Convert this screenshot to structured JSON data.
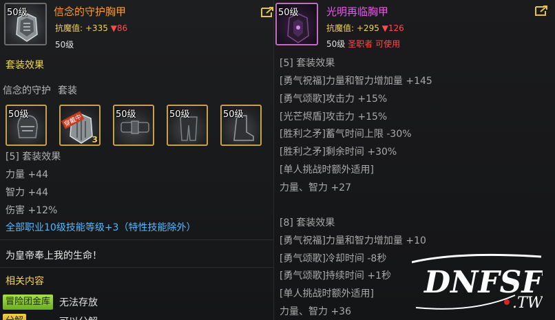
{
  "left": {
    "item": {
      "level": "50级",
      "name": "信念的守护胸甲",
      "stat_label": "抗魔值:",
      "stat_up": "+335",
      "stat_down": "▼86",
      "level_text": "50级"
    },
    "set_effect_title": "套装效果",
    "set_name": "信念的守护",
    "set_suffix": "套装",
    "set_slots": [
      {
        "level": "50级",
        "icon": "helmet-icon"
      },
      {
        "level": "",
        "icon": "chest-armor-icon",
        "banner": "穿戴中",
        "badge": "3"
      },
      {
        "level": "50级",
        "icon": "belt-icon"
      },
      {
        "level": "50级",
        "icon": "pants-icon"
      },
      {
        "level": "50级",
        "icon": "boots-icon"
      }
    ],
    "effects": [
      "[5] 套装效果",
      "力量 +44",
      "智力 +44",
      "伤害 +12%"
    ],
    "skill_bonus": "全部职业10级技能等级+3（特性技能除外）",
    "quote": "为皇帝奉上我的生命！",
    "related_title": "相关内容",
    "tags": [
      {
        "label": "冒险团金库",
        "desc": "无法存放",
        "color": "#8cc832"
      },
      {
        "label": "分解",
        "desc": "可以分解",
        "color": "#e0b030"
      }
    ]
  },
  "right": {
    "item": {
      "level": "50级",
      "name": "光明再临胸甲",
      "stat_label": "抗魔值:",
      "stat_up": "+295",
      "stat_down": "▼126",
      "level_text": "50级",
      "requirement": "圣职者 可使用"
    },
    "effects_5": [
      "[5] 套装效果",
      "[勇气祝福]力量和智力增加量 +145",
      "[勇气颂歌]攻击力 +15%",
      "[光芒烬盾]攻击力 +15%",
      "[胜利之矛]蓄气时间上限 -30%",
      "[胜利之矛]剩余时间 +30%",
      "[单人挑战时额外适用]",
      "力量、智力 +27"
    ],
    "effects_8": [
      "[8] 套装效果",
      "[勇气祝福]力量和智力增加量 +10",
      "[勇气颂歌]冷却时间 -8秒",
      "[勇气颂歌]持续时间 +1秒",
      "[单人挑战时额外适用]",
      "力量、智力 +36"
    ]
  },
  "watermark": {
    "text": "DNFSF",
    "sub": "TW"
  },
  "colors": {
    "title_orange": "#ff9a2e",
    "title_pink": "#ee55ee",
    "stat_yellow": "#f2d25c",
    "down_red": "#ff4a4a",
    "skill_blue": "#55b8ff"
  }
}
